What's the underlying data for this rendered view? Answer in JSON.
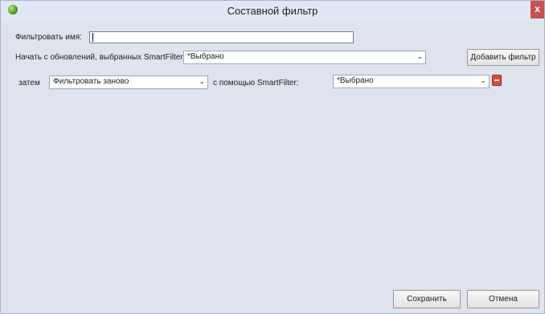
{
  "window": {
    "title": "Составной фильтр",
    "close_glyph": "x"
  },
  "filter_name": {
    "label": "Фильтровать имя:",
    "value": ""
  },
  "start": {
    "label": "Начать с обновлений, выбранных SmartFilter:",
    "selected": "*Выбрано",
    "add_button": "Добавить фильтр"
  },
  "rule": {
    "then_label": "затем",
    "action_selected": "Фильтровать заново",
    "using_label": "с помощью SmartFilter:",
    "smartfilter_selected": "*Выбрано"
  },
  "footer": {
    "save": "Сохранить",
    "cancel": "Отмена"
  },
  "icons": {
    "app": "green-globe-icon",
    "remove": "red-remove-icon",
    "dropdown": "chevron-down-icon"
  },
  "colors": {
    "titlebar": "#e1e7f5",
    "client": "#dfe3ee",
    "close": "#c75050",
    "remove": "#e04a33"
  }
}
